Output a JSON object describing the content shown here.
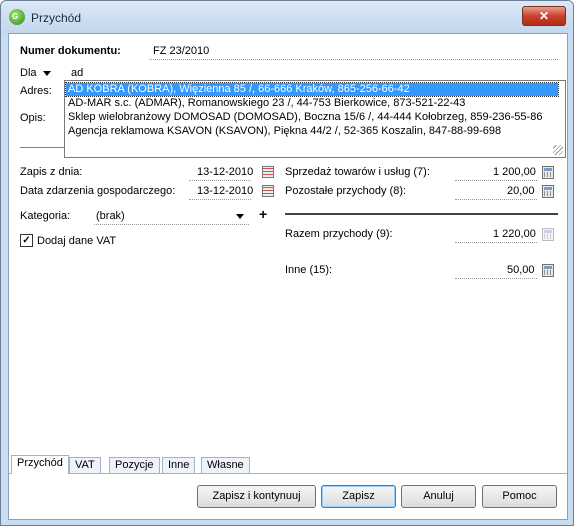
{
  "window": {
    "title": "Przychód",
    "close_label": "✕"
  },
  "form": {
    "numer_label": "Numer dokumentu:",
    "numer_value": "FZ 23/2010",
    "dla_label": "Dla",
    "dla_value": "ad",
    "adres_label": "Adres:",
    "opis_label": "Opis:",
    "autocomplete": [
      "AD KOBRA (KOBRA), Więzienna  85 /, 66-666 Kraków, 865-256-66-42",
      "AD-MAR s.c. (ADMAR), Romanowskiego 23 /, 44-753 Bierkowice, 873-521-22-43",
      "Sklep wielobranżowy DOMOSAD (DOMOSAD), Boczna  15/6 /, 44-444 Kołobrzeg, 859-236-55-86",
      "Agencja reklamowa KSAVON (KSAVON), Piękna  44/2 /, 52-365 Koszalin, 847-88-99-698"
    ],
    "zapis_label": "Zapis z dnia:",
    "zapis_value": "13-12-2010",
    "data_zdarzenia_label": "Data zdarzenia gospodarczego:",
    "data_zdarzenia_value": "13-12-2010",
    "kategoria_label": "Kategoria:",
    "kategoria_value": "(brak)",
    "plus_label": "+",
    "vat_label": "Dodaj dane VAT",
    "vat_checked": true,
    "sprzedaz_label": "Sprzedaż towarów i usług (7):",
    "sprzedaz_value": "1 200,00",
    "pozostale_label": "Pozostałe przychody (8):",
    "pozostale_value": "20,00",
    "razem_label": "Razem przychody (9):",
    "razem_value": "1 220,00",
    "inne_label": "Inne (15):",
    "inne_value": "50,00"
  },
  "tabs": [
    "Przychód",
    "VAT",
    "Pozycje",
    "Inne",
    "Własne"
  ],
  "buttons": {
    "zapisz_kontynuuj": "Zapisz i kontynuuj",
    "zapisz": "Zapisz",
    "anuluj": "Anuluj",
    "pomoc": "Pomoc"
  }
}
